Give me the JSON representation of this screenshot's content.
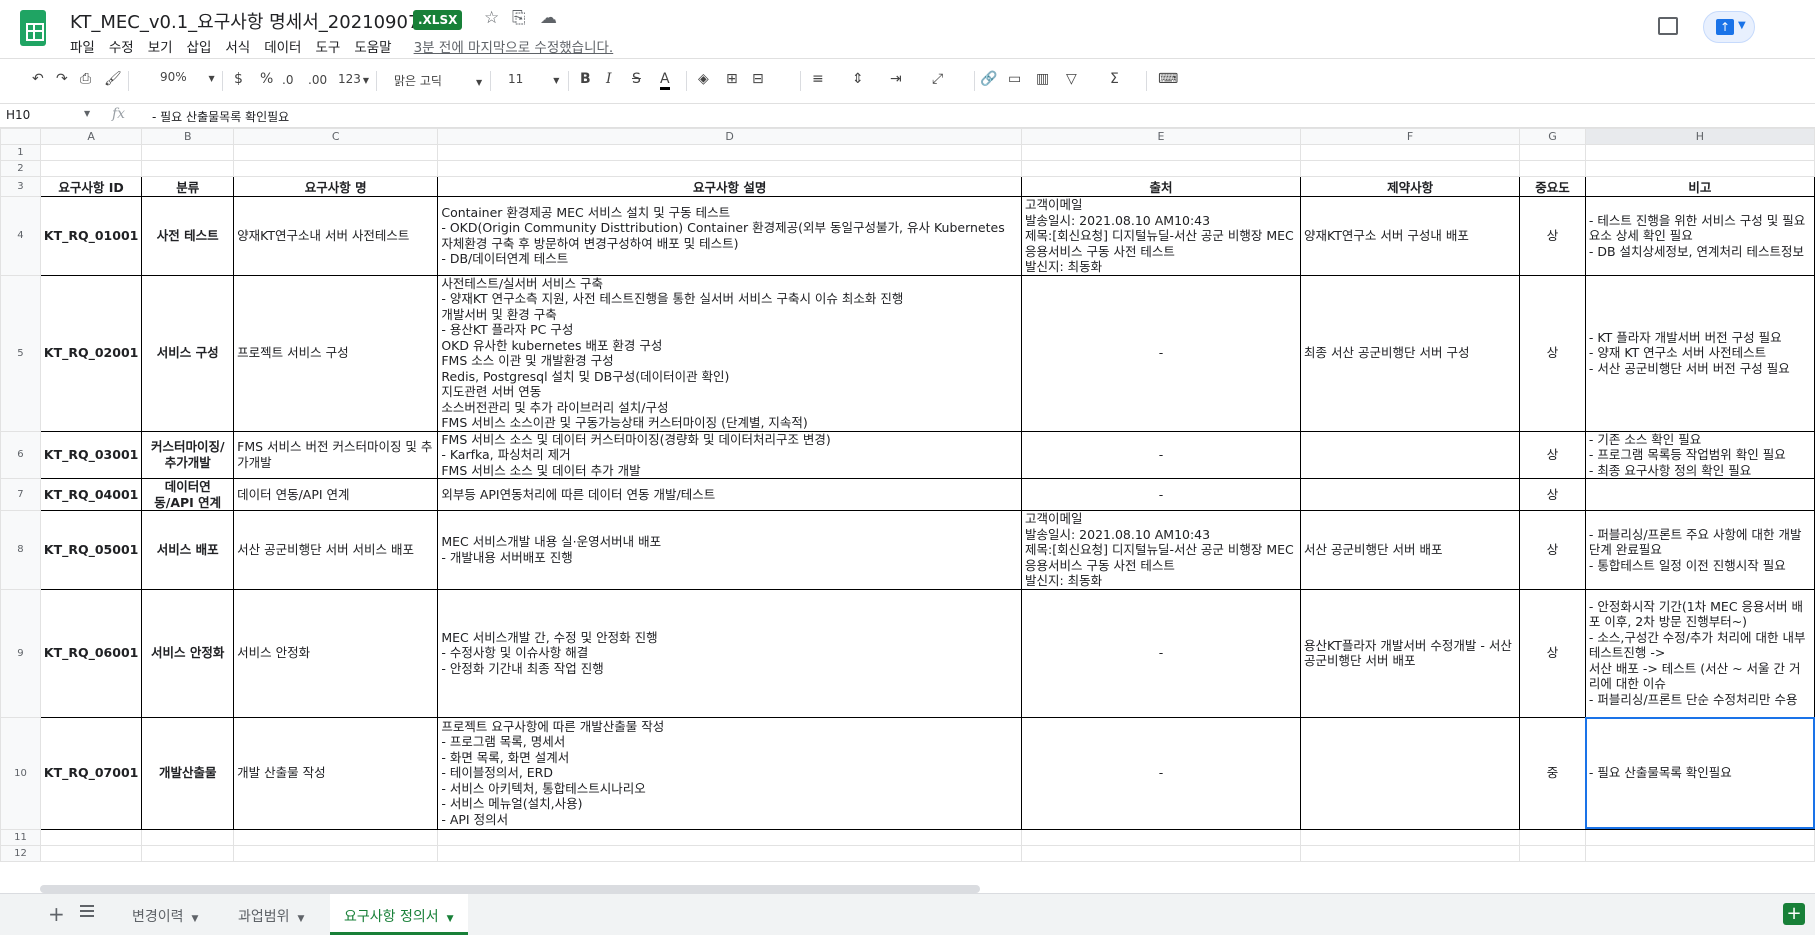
{
  "app": {
    "title": "KT_MEC_v0.1_요구사항 명세서_20210907",
    "badge": ".XLSX",
    "last_edit": "3분 전에 마지막으로 수정했습니다.",
    "menu": [
      "파일",
      "수정",
      "보기",
      "삽입",
      "서식",
      "데이터",
      "도구",
      "도움말"
    ]
  },
  "toolbar": {
    "zoom": "90%",
    "currency": "$",
    "percent": "%",
    "dec_decrease": ".0",
    "dec_increase": ".00",
    "more_formats": "123",
    "font": "맑은 고딕",
    "font_size": "11",
    "bold": "B",
    "italic": "I",
    "strike": "S",
    "text_color": "A"
  },
  "formula_bar": {
    "cell_ref": "H10",
    "fx": "fx",
    "value": "- 필요 산출물목록 확인필요"
  },
  "grid": {
    "columns": [
      "A",
      "B",
      "C",
      "D",
      "E",
      "F",
      "G",
      "H"
    ],
    "row_numbers": [
      "1",
      "2",
      "3",
      "4",
      "5",
      "6",
      "7",
      "8",
      "9",
      "10",
      "11",
      "12"
    ],
    "headers": [
      "요구사항 ID",
      "분류",
      "요구사항 명",
      "요구사항 설명",
      "출처",
      "제약사항",
      "중요도",
      "비고"
    ],
    "rows": [
      {
        "id": "KT_RQ_01001",
        "category": "사전 테스트",
        "name": "양재KT연구소내 서버 사전테스트",
        "desc": "Container 환경제공 MEC 서비스 설치 및 구동 테스트\n  - OKD(Origin Community Disttribution) Container 환경제공(외부 동일구성불가, 유사 Kubernetes 자체환경 구축 후 방문하여 변경구성하여 배포 및 테스트)\n  - DB/데이터연계 테스트",
        "source": "고객이메일\n발송일시: 2021.08.10 AM10:43\n제목:[회신요청] 디지털뉴딜-서산 공군 비행장 MEC 응용서비스 구동 사전 테스트\n발신지: 최동화",
        "constraint": "양재KT연구소 서버 구성내 배포",
        "priority": "상",
        "note": "- 테스트 진행을 위한 서비스 구성 및 필요요소 상세 확인 필요\n- DB 설치상세정보, 연계처리 테스트정보"
      },
      {
        "id": "KT_RQ_02001",
        "category": "서비스 구성",
        "name": "프로젝트 서비스 구성",
        "desc": "사전테스트/실서버 서비스 구축\n- 양재KT 연구소측 지원, 사전 테스트진행을 통한 실서버 서비스 구축시 이슈 최소화 진행\n개발서버 및 환경 구축\n- 용산KT 플라자 PC 구성\n  OKD 유사한 kubernetes 배포 환경 구성\n  FMS 소스 이관 및 개발환경 구성\n  Redis, Postgresql 설치 및 DB구성(데이터이관 확인)\n  지도관련 서버 연동\n  소스버전관리 및 추가 라이브러리 설치/구성\n  FMS 서비스 소스이관 및 구동가능상태 커스터마이징 (단계별, 지속적)",
        "source": "-",
        "constraint": "최종 서산 공군비행단 서버 구성",
        "priority": "상",
        "note": "- KT 플라자 개발서버 버전 구성 필요\n- 양재 KT 연구소 서버 사전테스트\n- 서산 공군비행단 서버 버전 구성 필요"
      },
      {
        "id": "KT_RQ_03001",
        "category": "커스터마이징/추가개발",
        "name": "FMS 서비스 버전 커스터마이징 및 추가개발",
        "desc": "FMS 서비스 소스 및 데이터 커스터마이징(경량화 및 데이터처리구조 변경)\n- Karfka, 파싱처리 제거\nFMS 서비스 소스 및 데이터 추가 개발",
        "source": "-",
        "constraint": "",
        "priority": "상",
        "note": "- 기존 소스 확인 필요\n- 프로그램 목록등 작업범위 확인 필요\n- 최종 요구사항 정의 확인 필요"
      },
      {
        "id": "KT_RQ_04001",
        "category": "데이터연동/API 연계",
        "name": "데이터 연동/API 연계",
        "desc": "외부등 API연동처리에 따른 데이터 연동 개발/테스트",
        "source": "-",
        "constraint": "",
        "priority": "상",
        "note": ""
      },
      {
        "id": "KT_RQ_05001",
        "category": "서비스 배포",
        "name": "서산 공군비행단 서버 서비스 배포",
        "desc": "MEC 서비스개발 내용 실·운영서버내 배포\n- 개발내용 서버배포 진행",
        "source": "고객이메일\n발송일시: 2021.08.10 AM10:43\n제목:[회신요청] 디지털뉴딜-서산 공군 비행장 MEC 응용서비스 구동 사전 테스트\n발신지: 최동화",
        "constraint": "서산 공군비행단 서버 배포",
        "priority": "상",
        "note": "- 퍼블리싱/프론트 주요 사항에 대한 개발단계 완료필요\n- 통합테스트 일정 이전 진행시작 필요"
      },
      {
        "id": "KT_RQ_06001",
        "category": "서비스 안정화",
        "name": "서비스 안정화",
        "desc": "MEC 서비스개발 간, 수정 및 안정화 진행\n  - 수정사항 및 이슈사항 해결\n  -  안정화 기간내 최종 작업 진행",
        "source": "-",
        "constraint": "용산KT플라자 개발서버 수정개발 - 서산 공군비행단 서버 배포",
        "priority": "상",
        "note": "- 안정화시작 기간(1차 MEC 응용서버 배포 이후, 2차 방문 진행부터~)\n- 소스,구성간 수정/추가 처리에 대한 내부 테스트진행 ->\n서산 배포 -> 테스트 (서산 ~ 서울 간 거리에 대한 이슈\n- 퍼블리싱/프론트 단순 수정처리만 수용"
      },
      {
        "id": "KT_RQ_07001",
        "category": "개발산출물",
        "name": "개발 산출물 작성",
        "desc": "프로젝트 요구사항에 따른 개발산출물 작성\n- 프로그램 목록, 명세서\n- 화면 목록, 화면 설계서\n- 테이블정의서, ERD\n- 서비스 아키텍처, 통합테스트시나리오\n- 서비스 메뉴얼(설치,사용)\n- API 정의서",
        "source": "-",
        "constraint": "",
        "priority": "중",
        "note": "- 필요 산출물목록 확인필요"
      }
    ]
  },
  "sheets": {
    "tabs": [
      "변경이력",
      "과업범위",
      "요구사항 정의서"
    ],
    "active": "요구사항 정의서"
  },
  "colors": {
    "accent": "#188038",
    "selection": "#1a73e8"
  }
}
